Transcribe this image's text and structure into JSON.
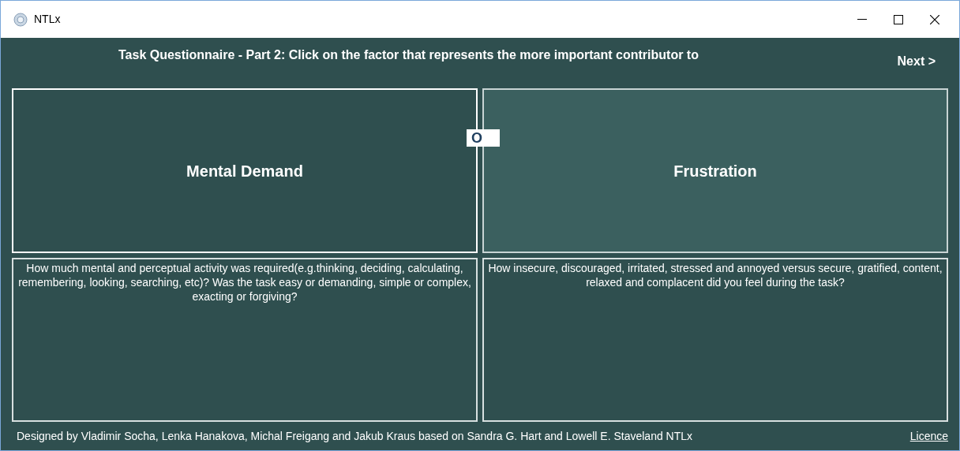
{
  "window": {
    "title": "NTLx"
  },
  "header": {
    "instruction": "Task Questionnaire - Part 2: Click on the factor that represents the more important contributor to",
    "next": "Next >"
  },
  "marker": "O",
  "factors": [
    {
      "name": "Mental Demand",
      "highlighted": false,
      "description": "How much mental and perceptual activity was required(e.g.thinking, deciding, calculating, remembering, looking, searching, etc)? Was the task easy or demanding, simple or complex, exacting or forgiving?"
    },
    {
      "name": "Frustration",
      "highlighted": true,
      "description": "How insecure, discouraged, irritated, stressed and annoyed versus secure, gratified, content, relaxed and complacent did you feel during the task?"
    }
  ],
  "footer": {
    "credits": "Designed by Vladimir Socha, Lenka Hanakova, Michal Freigang and Jakub Kraus based on Sandra G. Hart and Lowell E. Staveland NTLx",
    "licence": "Licence"
  }
}
